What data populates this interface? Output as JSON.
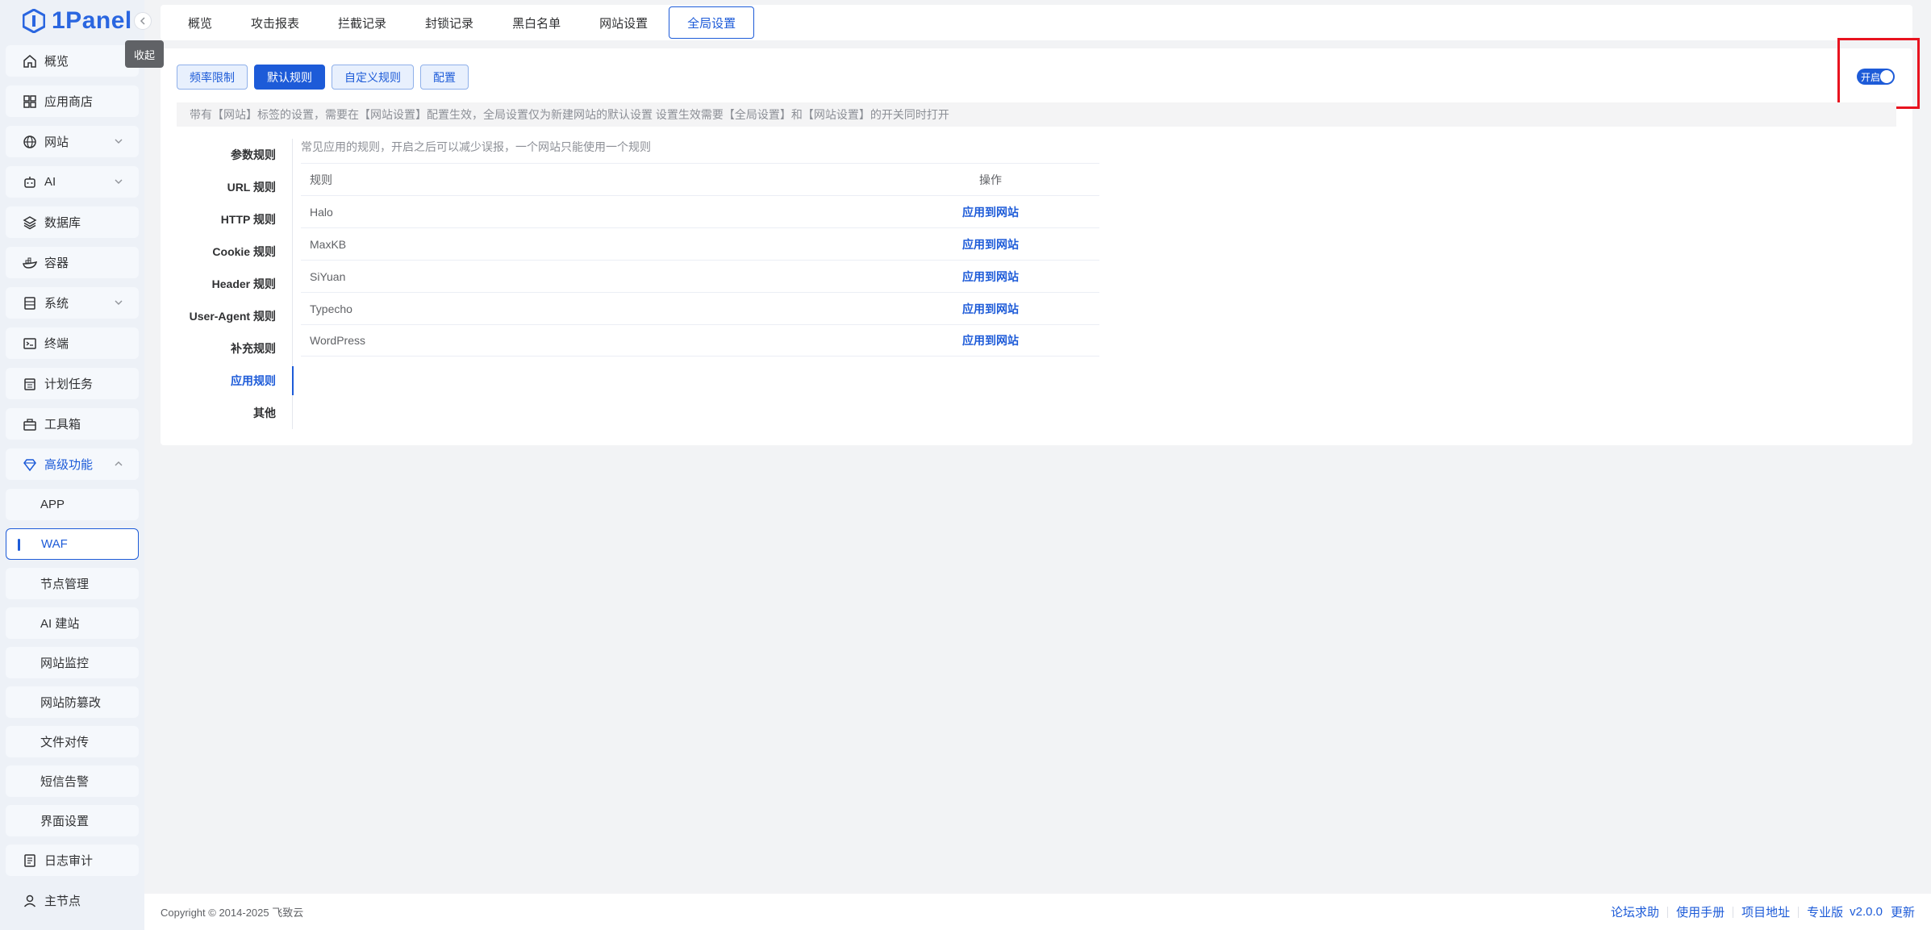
{
  "brand": {
    "logo_text": "1Panel",
    "tooltip": "收起"
  },
  "sidebar": {
    "items": [
      {
        "key": "overview",
        "label": "概览",
        "icon": "home-icon"
      },
      {
        "key": "appstore",
        "label": "应用商店",
        "icon": "grid-icon"
      },
      {
        "key": "website",
        "label": "网站",
        "icon": "globe-icon",
        "expandable": true
      },
      {
        "key": "ai",
        "label": "AI",
        "icon": "robot-icon",
        "expandable": true
      },
      {
        "key": "database",
        "label": "数据库",
        "icon": "layers-icon"
      },
      {
        "key": "container",
        "label": "容器",
        "icon": "whale-icon"
      },
      {
        "key": "system",
        "label": "系统",
        "icon": "server-icon",
        "expandable": true
      },
      {
        "key": "terminal",
        "label": "终端",
        "icon": "terminal-icon"
      },
      {
        "key": "cron",
        "label": "计划任务",
        "icon": "calendar-icon"
      },
      {
        "key": "toolbox",
        "label": "工具箱",
        "icon": "toolbox-icon"
      },
      {
        "key": "advanced",
        "label": "高级功能",
        "icon": "diamond-icon",
        "expanded": true
      }
    ],
    "sub_items": [
      {
        "label": "APP"
      },
      {
        "label": "WAF",
        "selected": true
      },
      {
        "label": "节点管理"
      },
      {
        "label": "AI 建站"
      },
      {
        "label": "网站监控"
      },
      {
        "label": "网站防篡改"
      },
      {
        "label": "文件对传"
      },
      {
        "label": "短信告警"
      },
      {
        "label": "界面设置"
      }
    ],
    "bottom_items": [
      {
        "label": "日志审计",
        "icon": "log-icon"
      },
      {
        "label": "主节点",
        "icon": "user-icon"
      }
    ]
  },
  "tabs": [
    "概览",
    "攻击报表",
    "拦截记录",
    "封锁记录",
    "黑白名单",
    "网站设置",
    "全局设置"
  ],
  "active_tab": "全局设置",
  "buttons": {
    "rate_limit": "频率限制",
    "default_rules": "默认规则",
    "custom_rules": "自定义规则",
    "config": "配置"
  },
  "toggle": {
    "label": "开启",
    "on": true
  },
  "notice": "带有【网站】标签的设置，需要在【网站设置】配置生效，全局设置仅为新建网站的默认设置 设置生效需要【全局设置】和【网站设置】的开关同时打开",
  "side_tabs": [
    "参数规则",
    "URL 规则",
    "HTTP 规则",
    "Cookie 规则",
    "Header 规则",
    "User-Agent 规则",
    "补充规则",
    "应用规则",
    "其他"
  ],
  "active_side_tab": "应用规则",
  "rules": {
    "description": "常见应用的规则，开启之后可以减少误报，一个网站只能使用一个规则",
    "col_rule": "规则",
    "col_action": "操作",
    "rows": [
      {
        "name": "Halo",
        "action": "应用到网站"
      },
      {
        "name": "MaxKB",
        "action": "应用到网站"
      },
      {
        "name": "SiYuan",
        "action": "应用到网站"
      },
      {
        "name": "Typecho",
        "action": "应用到网站"
      },
      {
        "name": "WordPress",
        "action": "应用到网站"
      }
    ]
  },
  "footer": {
    "copyright": "Copyright © 2014-2025 飞致云",
    "links": [
      "论坛求助",
      "使用手册",
      "项目地址"
    ],
    "edition": "专业版",
    "version": "v2.0.0",
    "update": "更新"
  },
  "colors": {
    "accent": "#1d5bd8",
    "highlight": "#e8131f"
  }
}
